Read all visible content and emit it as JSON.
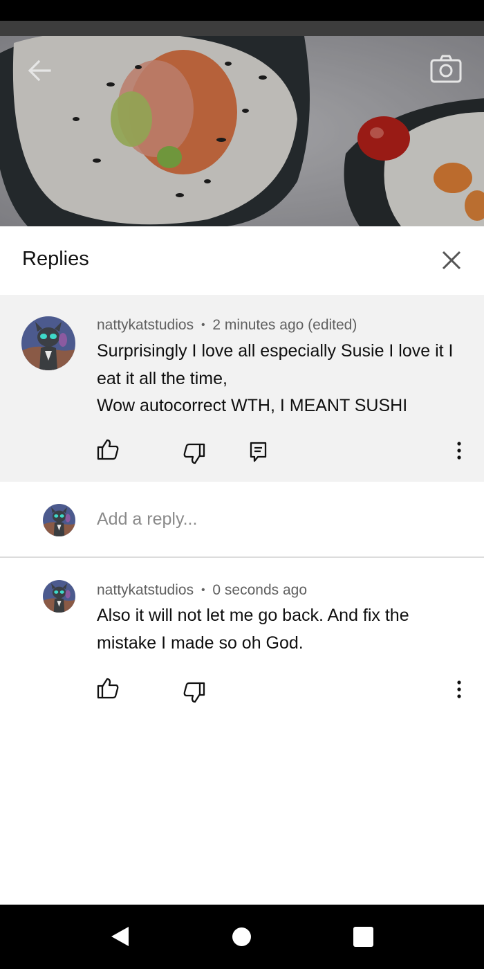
{
  "panel": {
    "title": "Replies"
  },
  "parent_comment": {
    "author": "nattykatstudios",
    "time": "2 minutes ago (edited)",
    "text": "Surprisingly I love all especially Susie I love it I eat it all the time,\nWow autocorrect WTH, I MEANT SUSHI"
  },
  "reply_input": {
    "placeholder": "Add a reply..."
  },
  "reply_comment": {
    "author": "nattykatstudios",
    "time": "0 seconds ago",
    "text": "Also it will not let me go back. And fix the mistake I made so oh God."
  },
  "meta_separator": "•",
  "icons": {
    "video_back": "arrow-left-icon",
    "video_camera": "camera-icon",
    "close": "close-icon",
    "like": "thumbs-up-icon",
    "dislike": "thumbs-down-icon",
    "reply": "comment-reply-icon",
    "more": "more-vertical-icon",
    "nav_back": "triangle-back-icon",
    "nav_home": "circle-home-icon",
    "nav_recent": "square-recents-icon"
  },
  "colors": {
    "sheet_background": "#ffffff",
    "highlighted_comment": "#f2f2f2",
    "meta_text": "#606060",
    "placeholder_text": "#8a8a8a"
  }
}
